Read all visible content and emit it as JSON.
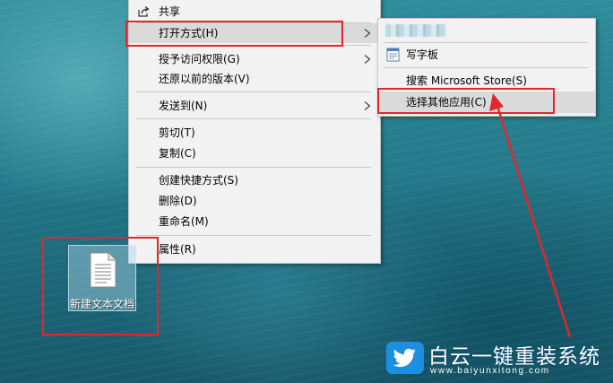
{
  "context_menu": {
    "items": [
      {
        "label": "共享",
        "icon": "share-icon"
      },
      {
        "label": "打开方式(H)",
        "has_submenu": true,
        "highlighted": true
      },
      {
        "label": "授予访问权限(G)",
        "has_submenu": true
      },
      {
        "label": "还原以前的版本(V)"
      },
      {
        "label": "发送到(N)",
        "has_submenu": true
      },
      {
        "label": "剪切(T)"
      },
      {
        "label": "复制(C)"
      },
      {
        "label": "创建快捷方式(S)"
      },
      {
        "label": "删除(D)"
      },
      {
        "label": "重命名(M)"
      },
      {
        "label": "属性(R)"
      }
    ]
  },
  "submenu": {
    "items": [
      {
        "label": "",
        "blurred": true
      },
      {
        "label": "写字板",
        "icon": "wordpad-icon"
      },
      {
        "label": "搜索 Microsoft Store(S)"
      },
      {
        "label": "选择其他应用(C)",
        "highlighted": true
      }
    ]
  },
  "desktop": {
    "icons": [
      {
        "label": "新建文本文档",
        "icon": "text-document-icon",
        "selected": true
      }
    ]
  },
  "annotations": {
    "box_color": "#e3262c",
    "arrow_color": "#e3262c"
  },
  "watermark": {
    "title": "白云一键重装系统",
    "url": "www.baiyunxitong.com",
    "logo": "twitter-bird-icon"
  },
  "colors": {
    "menu_bg": "#f2f2f2",
    "menu_highlight": "#dadada",
    "desktop": "#24798a"
  }
}
